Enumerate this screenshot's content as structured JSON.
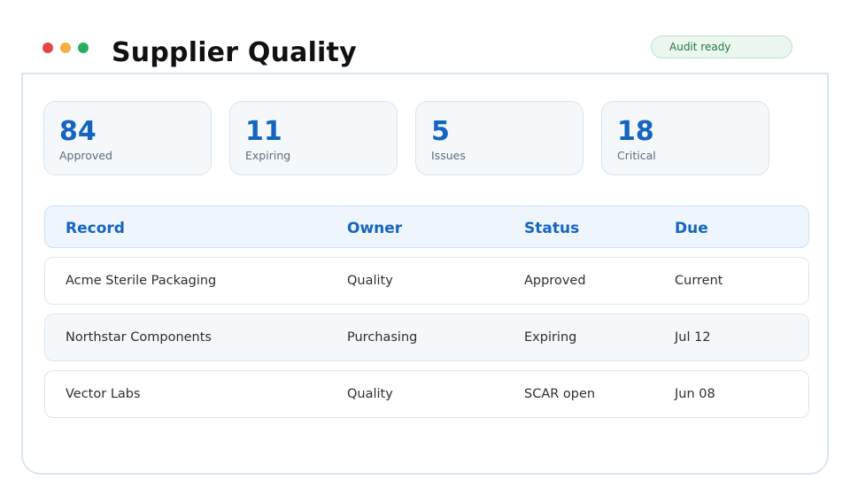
{
  "window": {
    "title": "Supplier Quality",
    "controls": [
      {
        "name": "close",
        "color": "#e64545"
      },
      {
        "name": "minimize",
        "color": "#f5b041"
      },
      {
        "name": "maximize",
        "color": "#27ae60"
      }
    ]
  },
  "badge": {
    "label": "Audit ready"
  },
  "stats": [
    {
      "value": "84",
      "label": "Approved"
    },
    {
      "value": "11",
      "label": "Expiring"
    },
    {
      "value": "5",
      "label": "Issues"
    },
    {
      "value": "18",
      "label": "Critical"
    }
  ],
  "table": {
    "headers": [
      "Record",
      "Owner",
      "Status",
      "Due"
    ],
    "rows": [
      [
        "Acme Sterile Packaging",
        "Quality",
        "Approved",
        "Current"
      ],
      [
        "Northstar Components",
        "Purchasing",
        "Expiring",
        "Jul 12"
      ],
      [
        "Vector Labs",
        "Quality",
        "SCAR open",
        "Jun 08"
      ]
    ]
  },
  "colors": {
    "accent": "#1565c0",
    "badge_text": "#217a45",
    "badge_bg": "#eaf6ee"
  }
}
